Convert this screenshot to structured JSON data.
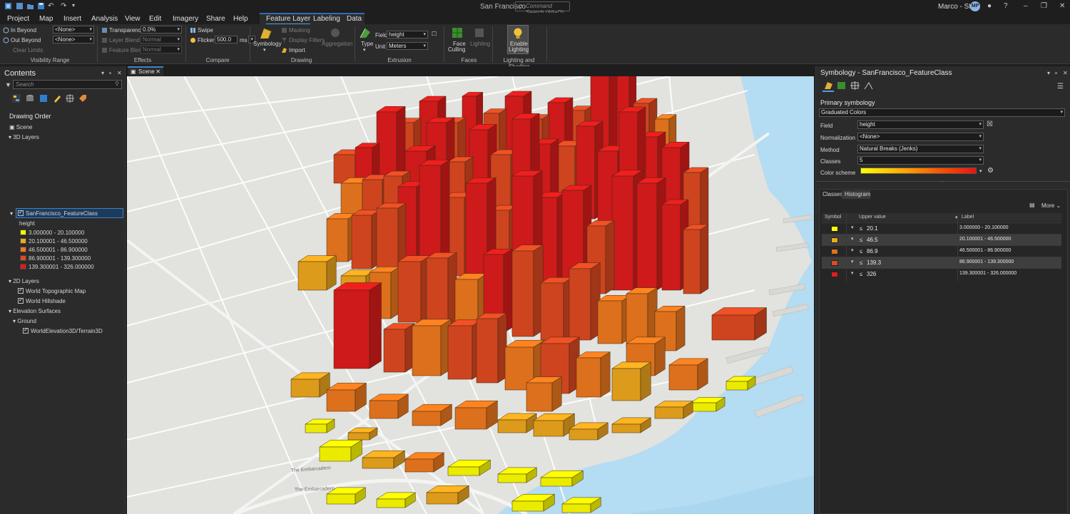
{
  "window": {
    "title": "San Francisco",
    "command_search_placeholder": "Command Search (Alt+Q)",
    "user_name": "Marco - Styx",
    "user_initials": "MP"
  },
  "menu": [
    "Project",
    "Map",
    "Insert",
    "Analysis",
    "View",
    "Edit",
    "Imagery",
    "Share",
    "Help"
  ],
  "context_tabs": {
    "feature_layer": "Feature Layer",
    "labeling": "Labeling",
    "data": "Data"
  },
  "ribbon": {
    "visibility": {
      "in_beyond": "In Beyond",
      "in_beyond_value": "<None>",
      "out_beyond": "Out Beyond",
      "out_beyond_value": "<None>",
      "clear_limits": "Clear Limits",
      "group": "Visibility Range"
    },
    "effects": {
      "transparency": "Transparency",
      "transparency_value": "0.0%",
      "layer_blend": "Layer Blend",
      "layer_blend_value": "Normal",
      "feature_blend": "Feature Blend",
      "feature_blend_value": "Normal",
      "group": "Effects"
    },
    "compare": {
      "swipe": "Swipe",
      "flicker": "Flicker",
      "flicker_value": "500.0",
      "flicker_unit": "ms",
      "group": "Compare"
    },
    "drawing": {
      "symbology": "Symbology",
      "masking": "Masking",
      "display_filters": "Display Filters",
      "import": "Import",
      "aggregation": "Aggregation",
      "group": "Drawing"
    },
    "extrusion": {
      "type": "Type",
      "field_label": "Field",
      "field_value": "height",
      "unit_label": "Unit",
      "unit_value": "Meters",
      "group": "Extrusion"
    },
    "faces": {
      "face_culling_1": "Face",
      "face_culling_2": "Culling",
      "lighting": "Lighting",
      "group": "Faces"
    },
    "lighting_shading": {
      "enable_1": "Enable",
      "enable_2": "Lighting",
      "group": "Lighting and Shading"
    }
  },
  "contents": {
    "title": "Contents",
    "search_placeholder": "Search",
    "drawing_order": "Drawing Order",
    "scene": "Scene",
    "layers_3d": "3D Layers",
    "feature_class": "SanFrancisco_FeatureClass",
    "field": "height",
    "legend": [
      {
        "label": "3.000000 - 20.100000",
        "color": "#ffff00"
      },
      {
        "label": "20.100001 - 46.500000",
        "color": "#f0a81e"
      },
      {
        "label": "46.500001 - 86.900000",
        "color": "#f07a1e"
      },
      {
        "label": "86.900001 - 139.300000",
        "color": "#e04a22"
      },
      {
        "label": "139.300001 - 326.000000",
        "color": "#e01c1c"
      }
    ],
    "layers_2d": "2D Layers",
    "topo": "World Topographic Map",
    "hillshade": "World Hillshade",
    "elevation_surfaces": "Elevation Surfaces",
    "ground": "Ground",
    "elevation": "WorldElevation3D/Terrain3D"
  },
  "scene_tab": "Scene",
  "map_labels": {
    "embarcadero_1": "The Embarcadero",
    "embarcadero_2": "The Embarcadero"
  },
  "symbology": {
    "title": "Symbology - SanFrancisco_FeatureClass",
    "primary": "Primary symbology",
    "renderer": "Graduated Colors",
    "field_label": "Field",
    "field_value": "height",
    "normalization_label": "Normalization",
    "normalization_value": "<None>",
    "method_label": "Method",
    "method_value": "Natural Breaks (Jenks)",
    "classes_label": "Classes",
    "classes_value": "5",
    "color_scheme_label": "Color scheme",
    "tab_classes": "Classes",
    "tab_histogram": "Histogram",
    "more": "More",
    "columns": {
      "symbol": "Symbol",
      "upper": "Upper value",
      "label": "Label"
    },
    "classes": [
      {
        "le": "≤",
        "upper": "20.1",
        "label": "3.000000 - 20.100000",
        "color": "#ffff00"
      },
      {
        "le": "≤",
        "upper": "46.5",
        "label": "20.100001 - 46.500000",
        "color": "#f0a81e"
      },
      {
        "le": "≤",
        "upper": "86.9",
        "label": "46.500001 - 86.900000",
        "color": "#f07a1e"
      },
      {
        "le": "≤",
        "upper": "139.3",
        "label": "86.900001 - 139.300000",
        "color": "#e04a22"
      },
      {
        "le": "≤",
        "upper": "326",
        "label": "139.300001 - 326.000000",
        "color": "#e01c1c"
      }
    ]
  }
}
